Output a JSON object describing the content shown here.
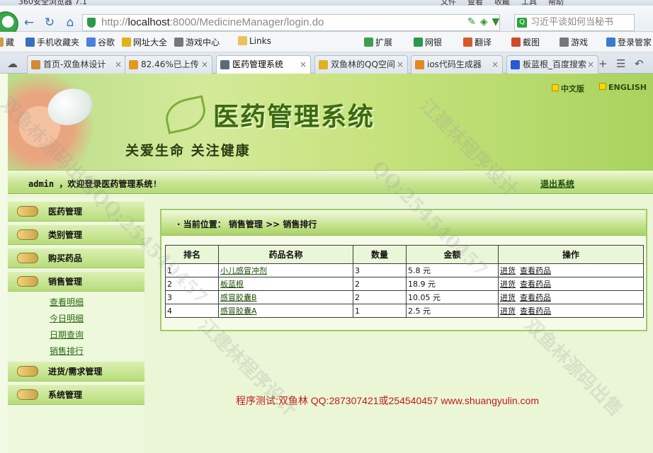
{
  "browser": {
    "title_fragments": [
      "360安全浏览器 7.1",
      "文件",
      "查看",
      "收藏",
      "工具",
      "帮助"
    ],
    "url_prefix": "http://",
    "url_host": "localhost",
    "url_rest": ":8000/MedicineManager/login.do",
    "search_placeholder": "习近平谈如何当秘书",
    "bookmarks": [
      {
        "label": "藏",
        "icon": "bookmark-folder-icon",
        "color": "#caa040"
      },
      {
        "label": "手机收藏夹",
        "icon": "phone-icon",
        "color": "#3a6fc0"
      },
      {
        "label": "谷歌",
        "icon": "google-icon",
        "color": "#4a7fe0"
      },
      {
        "label": "网址大全",
        "icon": "globe-icon",
        "color": "#e2b214"
      },
      {
        "label": "游戏中心",
        "icon": "gamepad-icon",
        "color": "#777"
      },
      {
        "label": "Links",
        "icon": "folder-icon",
        "color": "#e9c25a"
      },
      {
        "label": "扩展",
        "icon": "puzzle-icon",
        "color": "#3ca04a"
      },
      {
        "label": "网银",
        "icon": "bank-icon",
        "color": "#2a9a4a"
      },
      {
        "label": "翻译",
        "icon": "translate-icon",
        "color": "#d55a2a"
      },
      {
        "label": "截图",
        "icon": "scissors-icon",
        "color": "#cf4a2a"
      },
      {
        "label": "游戏",
        "icon": "game-icon",
        "color": "#777"
      },
      {
        "label": "登录管家",
        "icon": "key-icon",
        "color": "#3a7ad0"
      }
    ],
    "tabs": [
      {
        "label": "首页-双鱼林设计",
        "icon": "tab-page-icon",
        "color": "#d08a3a",
        "active": false
      },
      {
        "label": "82.46%已上传",
        "icon": "upload-icon",
        "color": "#e09a20",
        "active": false
      },
      {
        "label": "医药管理系统",
        "icon": "tab-page-icon",
        "color": "#5a6a7a",
        "active": true
      },
      {
        "label": "双鱼林的QQ空间",
        "icon": "star-icon",
        "color": "#e0b020",
        "active": false
      },
      {
        "label": "ios代码生成器",
        "icon": "tab-page-icon",
        "color": "#e08a20",
        "active": false
      },
      {
        "label": "板蓝根_百度搜索",
        "icon": "baidu-icon",
        "color": "#2a5ad0",
        "active": false
      }
    ]
  },
  "banner": {
    "title": "医药管理系统",
    "slogan": "关爱生命  关注健康",
    "lang_cn": "中文版",
    "lang_en": "ENGLISH"
  },
  "welcome": {
    "text": "admin ，欢迎登录医药管理系统!",
    "logout": "退出系统"
  },
  "sidebar": {
    "menus": [
      {
        "label": "医药管理"
      },
      {
        "label": "类别管理"
      },
      {
        "label": "购买药品"
      },
      {
        "label": "销售管理"
      },
      {
        "label": "进货/需求管理"
      },
      {
        "label": "系统管理"
      }
    ],
    "sales_sub": [
      "查看明细",
      "今日明细",
      "日期查询",
      "销售排行"
    ]
  },
  "breadcrumb": "· 当前位置：  销售管理  >> 销售排行",
  "table": {
    "headers": [
      "排名",
      "药品名称",
      "数量",
      "金额",
      "操作"
    ],
    "rows": [
      {
        "rank": "1",
        "name": "小儿感冒冲剂",
        "qty": "3",
        "amount": "5.8 元",
        "op1": "进货",
        "op2": "查看药品"
      },
      {
        "rank": "2",
        "name": "板蓝根",
        "qty": "2",
        "amount": "18.9 元",
        "op1": "进货",
        "op2": "查看药品"
      },
      {
        "rank": "3",
        "name": "感冒胶囊B",
        "qty": "2",
        "amount": "10.05 元",
        "op1": "进货",
        "op2": "查看药品"
      },
      {
        "rank": "4",
        "name": "感冒胶囊A",
        "qty": "1",
        "amount": "2.5 元",
        "op1": "进货",
        "op2": "查看药品"
      }
    ]
  },
  "footer": "程序测试:双鱼林 QQ:287307421或254540457 www.shuangyulin.com",
  "watermarks": [
    "江建林程序设计",
    "QQ:254540457",
    "双鱼林源码出售",
    "双鱼林源码出售QQ:254540457",
    "江建林程序设计"
  ]
}
